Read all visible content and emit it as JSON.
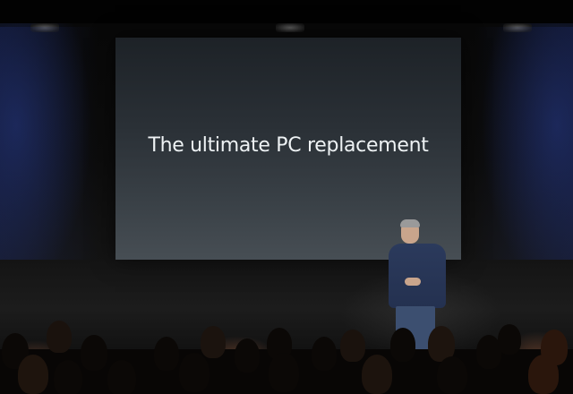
{
  "slide": {
    "title": "The ultimate PC replacement"
  },
  "colors": {
    "screen_top": "#1d2227",
    "screen_bottom": "#474e54",
    "title_text": "#eef2f4",
    "side_glow": "#283c8c",
    "presenter_shirt": "#2b3a5c",
    "presenter_jeans": "#3c4f70"
  }
}
